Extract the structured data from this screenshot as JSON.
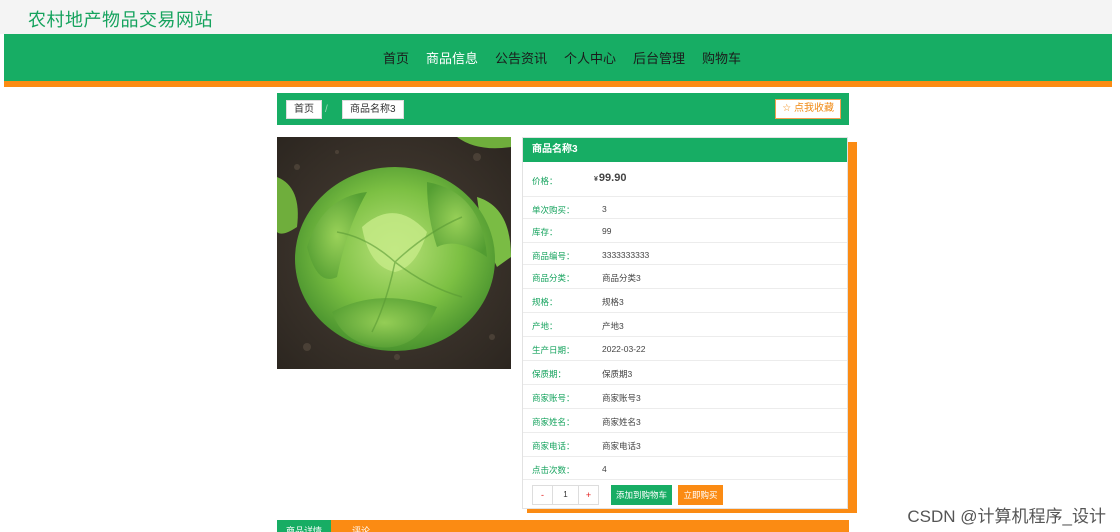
{
  "site": {
    "title": "农村地产物品交易网站"
  },
  "nav": {
    "items": [
      {
        "label": "首页"
      },
      {
        "label": "商品信息"
      },
      {
        "label": "公告资讯"
      },
      {
        "label": "个人中心"
      },
      {
        "label": "后台管理"
      },
      {
        "label": "购物车"
      }
    ]
  },
  "breadcrumb": {
    "home": "首页",
    "separator": "/",
    "current": "商品名称3",
    "favorite": "☆ 点我收藏"
  },
  "product": {
    "name": "商品名称3",
    "price": {
      "label": "价格：",
      "currency": "¥",
      "value": "99.90"
    },
    "fields": [
      {
        "label": "单次购买：",
        "value": "3"
      },
      {
        "label": "库存：",
        "value": "99"
      },
      {
        "label": "商品编号：",
        "value": "3333333333"
      },
      {
        "label": "商品分类：",
        "value": "商品分类3"
      },
      {
        "label": "规格：",
        "value": "规格3"
      },
      {
        "label": "产地：",
        "value": "产地3"
      },
      {
        "label": "生产日期：",
        "value": "2022-03-22"
      },
      {
        "label": "保质期：",
        "value": "保质期3"
      },
      {
        "label": "商家账号：",
        "value": "商家账号3"
      },
      {
        "label": "商家姓名：",
        "value": "商家姓名3"
      },
      {
        "label": "商家电话：",
        "value": "商家电话3"
      },
      {
        "label": "点击次数：",
        "value": "4"
      }
    ]
  },
  "purchase": {
    "minus": "-",
    "quantity": "1",
    "plus": "+",
    "add_to_cart": "添加到购物车",
    "buy_now": "立即购买"
  },
  "tabs": {
    "detail": "商品详情",
    "comment": "评论"
  },
  "watermark": "CSDN @计算机程序_设计",
  "colors": {
    "brand_green": "#17ad64",
    "accent_orange": "#fb8b13",
    "price_red": "#e31b1b"
  }
}
